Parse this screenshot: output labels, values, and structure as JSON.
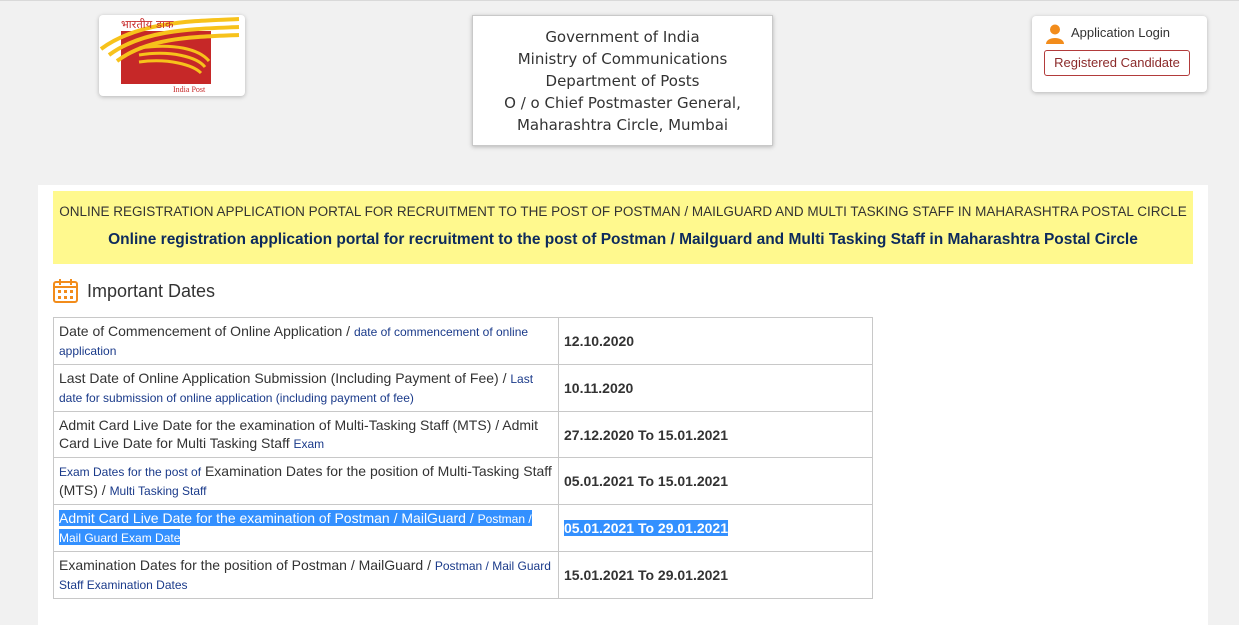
{
  "logo": {
    "hindi_text": "भारतीय डाक",
    "english_text": "India Post",
    "colors": {
      "red": "#c62828",
      "yellow": "#f7c21b"
    }
  },
  "header": {
    "lines": [
      "Government of India",
      "Ministry of Communications",
      "Department of Posts",
      "O / o Chief Postmaster General,",
      "Maharashtra Circle, Mumbai"
    ]
  },
  "login": {
    "icon": "user-icon",
    "label": "Application Login",
    "button_label": "Registered Candidate"
  },
  "banner": {
    "upper": "ONLINE REGISTRATION APPLICATION PORTAL FOR RECRUITMENT TO THE POST OF POSTMAN / MAILGUARD AND MULTI TASKING STAFF IN MAHARASHTRA POSTAL CIRCLE",
    "title": "Online registration application portal for recruitment to the post of Postman / Mailguard and Multi Tasking Staff in Maharashtra Postal Circle",
    "background": "#fff98e"
  },
  "important_dates": {
    "icon": "calendar-icon",
    "title": "Important Dates",
    "rows": [
      {
        "prefix_small": "",
        "main": "Date of Commencement of Online Application",
        "sep": " / ",
        "small": "date of commencement of online application",
        "value": "12.10.2020",
        "selected": false
      },
      {
        "prefix_small": "",
        "main": "Last Date of Online Application Submission (Including Payment of Fee)",
        "sep": " / ",
        "small": "Last date for submission of online application (including payment of fee)",
        "value": "10.11.2020",
        "selected": false
      },
      {
        "prefix_small": "",
        "main": "Admit Card Live Date for the examination of Multi-Tasking Staff (MTS) / Admit Card Live Date for Multi Tasking Staff",
        "sep": " ",
        "small": "Exam",
        "value": "27.12.2020 To 15.01.2021",
        "selected": false
      },
      {
        "prefix_small": "Exam Dates for the post of",
        "main": "Examination Dates for the position of Multi-Tasking Staff (MTS)",
        "sep": " / ",
        "small": "Multi Tasking Staff",
        "value": "05.01.2021 To 15.01.2021",
        "selected": false
      },
      {
        "prefix_small": "",
        "main": "Admit Card Live Date for the examination of Postman / MailGuard",
        "sep": " / ",
        "small": "Postman / Mail Guard Exam Date",
        "value": "05.01.2021 To 29.01.2021",
        "selected": true
      },
      {
        "prefix_small": "",
        "main": "Examination Dates for the position of Postman / MailGuard",
        "sep": " / ",
        "small": "Postman / Mail Guard Staff Examination Dates",
        "value": "15.01.2021 To 29.01.2021",
        "selected": false
      }
    ]
  }
}
